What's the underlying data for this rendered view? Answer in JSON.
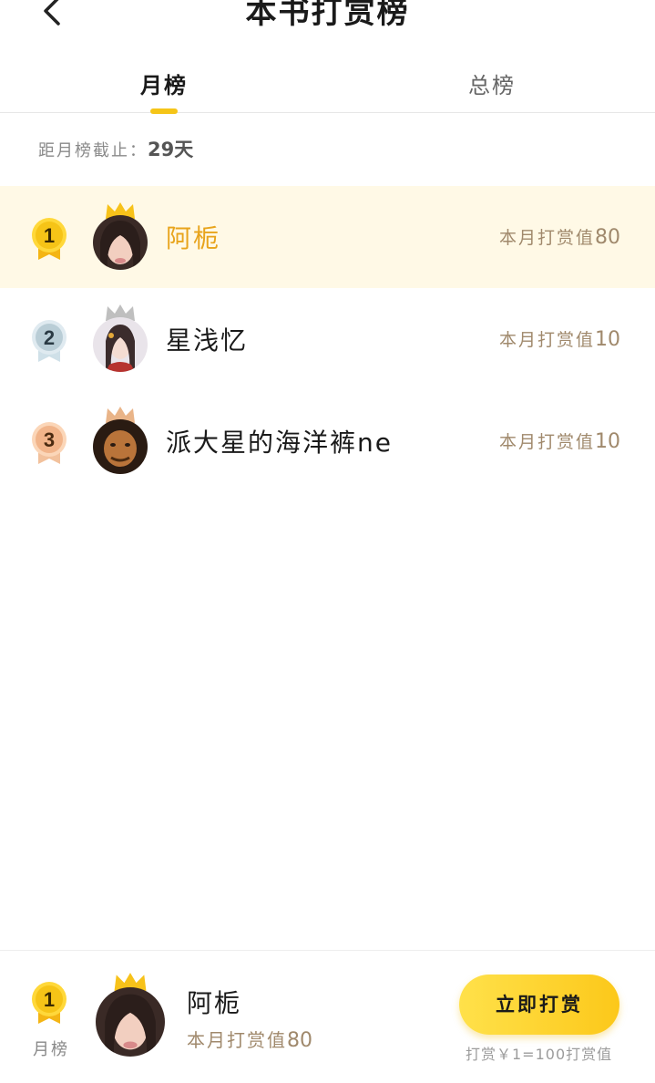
{
  "header": {
    "title": "本书打赏榜"
  },
  "tabs": [
    {
      "label": "月榜",
      "active": true
    },
    {
      "label": "总榜",
      "active": false
    }
  ],
  "deadline": {
    "label": "距月榜截止：",
    "days": "29天"
  },
  "ranking": [
    {
      "rank": "1",
      "name": "阿栀",
      "reward_label": "本月打赏值",
      "reward_value": "80",
      "medal": "gold",
      "crown": "gold"
    },
    {
      "rank": "2",
      "name": "星浅忆",
      "reward_label": "本月打赏值",
      "reward_value": "10",
      "medal": "silver",
      "crown": "silver"
    },
    {
      "rank": "3",
      "name": "派大星的海洋裤ne",
      "reward_label": "本月打赏值",
      "reward_value": "10",
      "medal": "bronze",
      "crown": "bronze"
    }
  ],
  "my_rank": {
    "rank": "1",
    "rank_label": "月榜",
    "name": "阿栀",
    "reward_label": "本月打赏值",
    "reward_value": "80"
  },
  "reward_button": {
    "label": "立即打赏"
  },
  "rate_note": "打赏￥1=100打赏值",
  "colors": {
    "accent": "#f5c518",
    "highlight_row": "#fff9e6",
    "first_name": "#e8a41c",
    "reward_text": "#a0896c",
    "gold": "#f6c417",
    "silver": "#b9cdd6",
    "bronze": "#f1b48a"
  }
}
